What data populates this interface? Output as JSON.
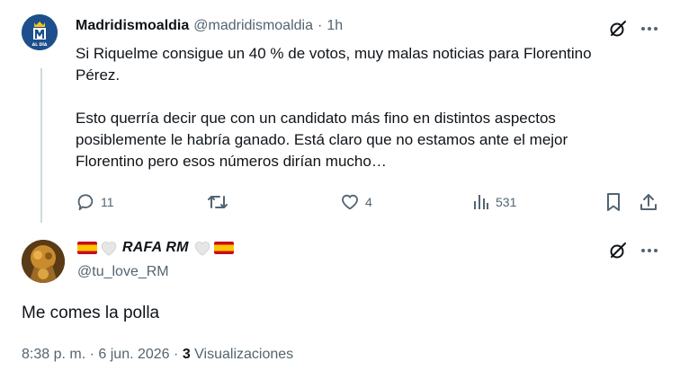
{
  "tweet1": {
    "name": "Madridismoaldia",
    "handle": "@madridismoaldia",
    "separator": "·",
    "time": "1h",
    "avatar_text": "AL DÍA",
    "text_line1": "Si Riquelme consigue un 40 % de votos, muy malas noticias para Florentino",
    "text_line2": "Pérez.",
    "text_line3": "Esto querría decir que con un candidato más fino en distintos aspectos",
    "text_line4": "posiblemente le habría ganado. Está claro que no estamos ante el mejor",
    "text_line5": "Florentino pero esos números dirían mucho…",
    "actions": {
      "replies": "11",
      "retweets": "",
      "likes": "4",
      "views": "531"
    }
  },
  "tweet2": {
    "name": "RAFA RM",
    "handle": "@tu_love_RM",
    "text": "Me comes la polla",
    "time": "8:38 p. m.",
    "sep1": "·",
    "date": "6 jun. 2026",
    "sep2": "·",
    "views_count": "3",
    "views_label": "Visualizaciones"
  },
  "colors": {
    "text": "#0f1419",
    "secondary": "#536471",
    "thread_line": "#cfd9de",
    "avatar_blue": "#1d4f8c",
    "flag_red": "#c60b1e",
    "flag_yellow": "#ffc400"
  },
  "icons": [
    "grok-icon",
    "more-icon",
    "reply-icon",
    "retweet-icon",
    "like-icon",
    "views-icon",
    "bookmark-icon",
    "share-icon",
    "heart-white-icon",
    "spain-flag-icon"
  ]
}
